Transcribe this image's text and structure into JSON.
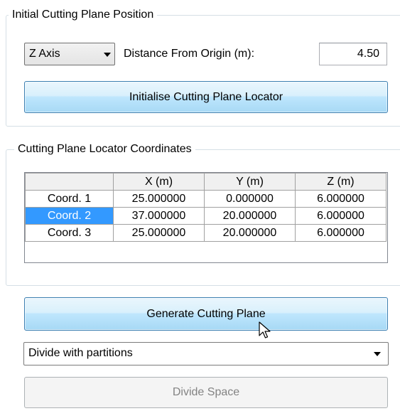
{
  "initial_group": {
    "title": "Initial Cutting Plane Position",
    "axis_select": {
      "value": "Z Axis"
    },
    "distance_label": "Distance From Origin (m):",
    "distance_value": "4.50",
    "init_button": "Initialise Cutting Plane Locator"
  },
  "coords_group": {
    "title": "Cutting Plane Locator Coordinates",
    "columns": [
      "",
      "X (m)",
      "Y (m)",
      "Z (m)"
    ],
    "rows": [
      {
        "label": "Coord. 1",
        "x": "25.000000",
        "y": "0.000000",
        "z": "6.000000"
      },
      {
        "label": "Coord. 2",
        "x": "37.000000",
        "y": "20.000000",
        "z": "6.000000"
      },
      {
        "label": "Coord. 3",
        "x": "25.000000",
        "y": "20.000000",
        "z": "6.000000"
      }
    ],
    "selected_row": 1
  },
  "generate_button": "Generate Cutting Plane",
  "divide_select": {
    "value": "Divide with partitions"
  },
  "divide_button": "Divide Space",
  "icons": {
    "combo_arrow": "chevron-down-icon",
    "cursor": "mouse-pointer-icon"
  },
  "colors": {
    "selection": "#3399ff",
    "button_border": "#3c7fb1",
    "disabled_text": "#838383"
  }
}
